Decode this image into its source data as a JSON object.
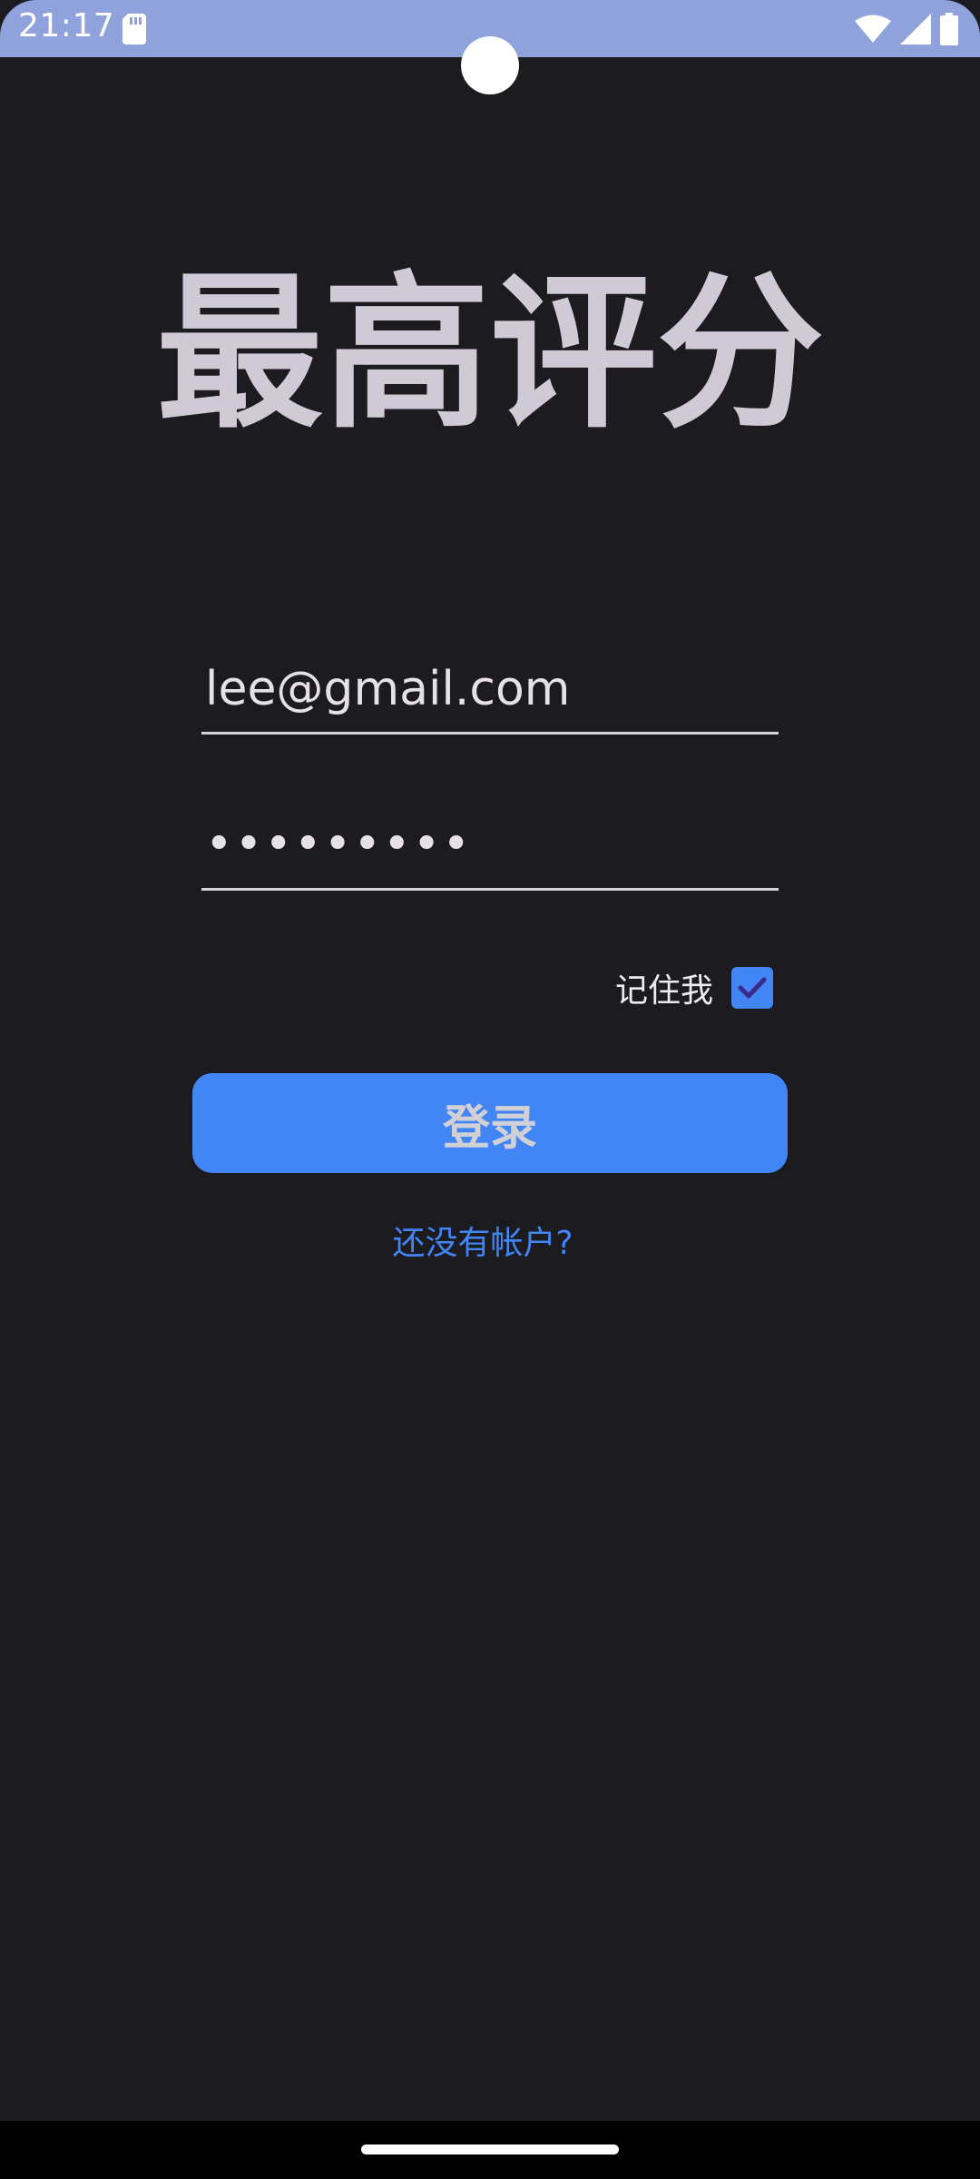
{
  "status_bar": {
    "time": "21:17",
    "icons": [
      "sd-card-icon",
      "wifi-icon",
      "cell-signal-icon",
      "battery-icon"
    ]
  },
  "app": {
    "title": "最高评分"
  },
  "login_form": {
    "email_value": "lee@gmail.com",
    "password_value": "•••••••••",
    "remember_label": "记住我",
    "remember_checked": true,
    "login_label": "登录",
    "register_link": "还没有帐户?"
  },
  "colors": {
    "background": "#1c1b20",
    "status_bar": "#8fa2dc",
    "accent": "#4285f4",
    "title": "#cfcad6"
  }
}
